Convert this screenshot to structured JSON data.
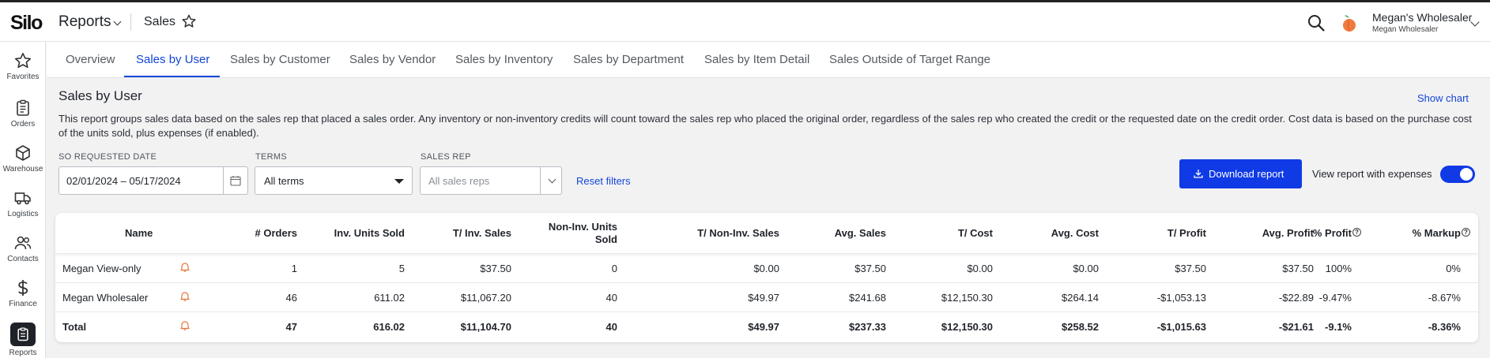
{
  "header": {
    "logo": "Silo",
    "module": "Reports",
    "page_title": "Sales",
    "user": {
      "name": "Megan's Wholesaler",
      "org": "Megan Wholesaler"
    }
  },
  "leftnav": [
    {
      "label": "Favorites",
      "icon": "star-icon"
    },
    {
      "label": "Orders",
      "icon": "clipboard-icon"
    },
    {
      "label": "Warehouse",
      "icon": "cube-icon"
    },
    {
      "label": "Logistics",
      "icon": "truck-icon"
    },
    {
      "label": "Contacts",
      "icon": "people-icon"
    },
    {
      "label": "Finance",
      "icon": "dollar-icon"
    },
    {
      "label": "Reports",
      "icon": "reports-icon",
      "active": true
    }
  ],
  "tabs": [
    {
      "label": "Overview"
    },
    {
      "label": "Sales by User",
      "active": true
    },
    {
      "label": "Sales by Customer"
    },
    {
      "label": "Sales by Vendor"
    },
    {
      "label": "Sales by Inventory"
    },
    {
      "label": "Sales by Department"
    },
    {
      "label": "Sales by Item Detail"
    },
    {
      "label": "Sales Outside of Target Range"
    }
  ],
  "main": {
    "title": "Sales by User",
    "show_chart": "Show chart",
    "description": "This report groups sales data based on the sales rep that placed a sales order. Any inventory or non-inventory credits will count toward the sales rep who placed the original order, regardless of the sales rep who created the credit or the requested date on the credit order. Cost data is based on the purchase cost of the units sold, plus expenses (if enabled).",
    "filters": {
      "date_label": "SO Requested Date",
      "date_value": "02/01/2024  –  05/17/2024",
      "terms_label": "Terms",
      "terms_value": "All terms",
      "rep_label": "Sales Rep",
      "rep_placeholder": "All sales reps",
      "reset": "Reset filters"
    },
    "download_label": "Download report",
    "expenses_toggle_label": "View report with expenses",
    "expenses_toggle_on": true
  },
  "table": {
    "headers": {
      "name": "Name",
      "orders": "# Orders",
      "inv_units": "Inv. Units Sold",
      "t_inv_sales": "T/ Inv. Sales",
      "noninv_units_1": "Non-Inv. Units",
      "noninv_units_2": "Sold",
      "t_noninv_sales": "T/ Non-Inv. Sales",
      "avg_sales": "Avg. Sales",
      "t_cost": "T/ Cost",
      "avg_cost": "Avg. Cost",
      "t_profit": "T/ Profit",
      "avg_profit": "Avg. Profit",
      "pct_profit": "% Profit",
      "pct_markup": "% Markup"
    },
    "rows": [
      {
        "name": "Megan View-only",
        "orders": "1",
        "inv_units": "5",
        "t_inv_sales": "$37.50",
        "noninv_units": "0",
        "t_noninv_sales": "$0.00",
        "avg_sales": "$37.50",
        "t_cost": "$0.00",
        "avg_cost": "$0.00",
        "t_profit": "$37.50",
        "avg_profit": "$37.50",
        "pct_profit": "100%",
        "pct_markup": "0%"
      },
      {
        "name": "Megan Wholesaler",
        "orders": "46",
        "inv_units": "611.02",
        "t_inv_sales": "$11,067.20",
        "noninv_units": "40",
        "t_noninv_sales": "$49.97",
        "avg_sales": "$241.68",
        "t_cost": "$12,150.30",
        "avg_cost": "$264.14",
        "t_profit": "-$1,053.13",
        "avg_profit": "-$22.89",
        "pct_profit": "-9.47%",
        "pct_markup": "-8.67%"
      },
      {
        "name": "Total",
        "orders": "47",
        "inv_units": "616.02",
        "t_inv_sales": "$11,104.70",
        "noninv_units": "40",
        "t_noninv_sales": "$49.97",
        "avg_sales": "$237.33",
        "t_cost": "$12,150.30",
        "avg_cost": "$258.52",
        "t_profit": "-$1,015.63",
        "avg_profit": "-$21.61",
        "pct_profit": "-9.1%",
        "pct_markup": "-8.36%"
      }
    ]
  },
  "colors": {
    "accent": "#0f3ae6",
    "link": "#1346d6"
  }
}
